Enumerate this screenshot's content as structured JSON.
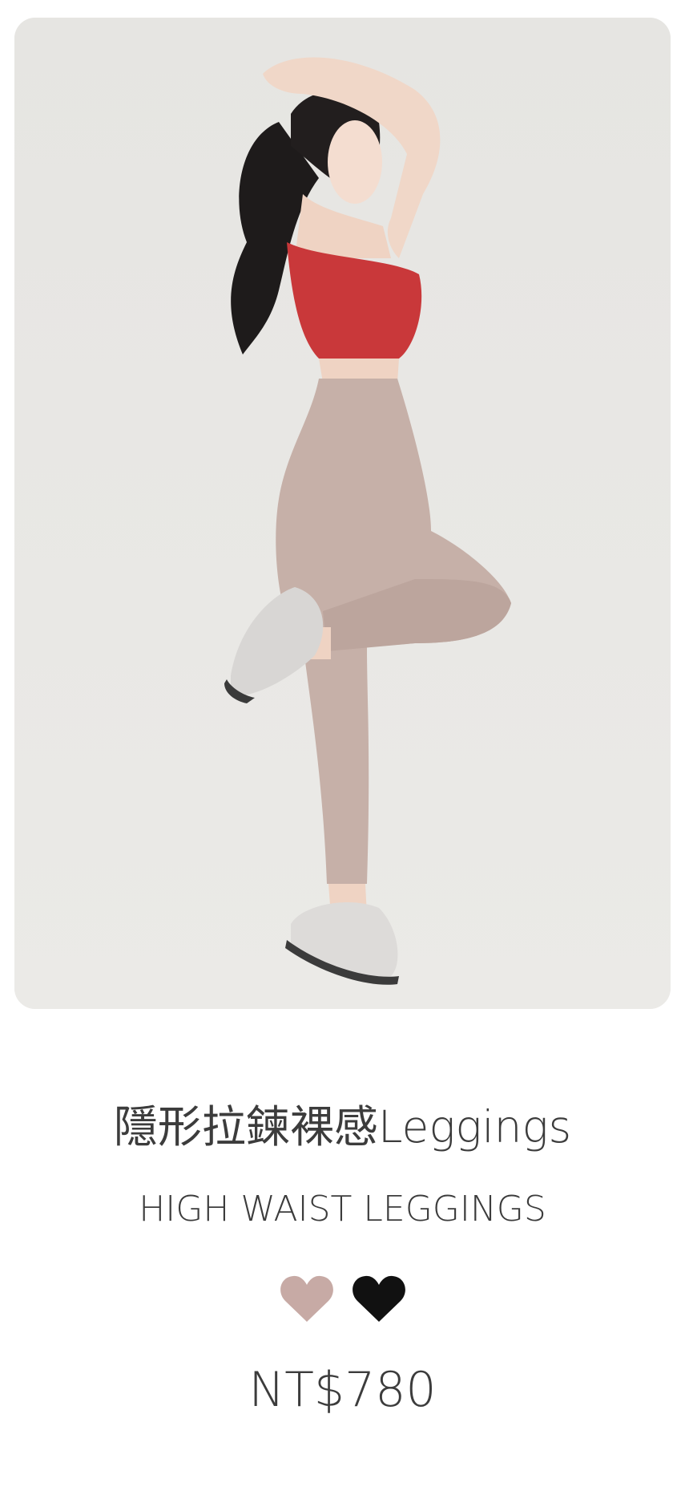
{
  "product": {
    "title": "隱形拉鍊裸感Leggings",
    "subtitle": "HIGH WAIST LEGGINGS",
    "price": "NT$780",
    "image_alt": "Model posing in red sports bra and taupe high waist leggings",
    "colors": [
      {
        "name": "taupe-swatch",
        "hex": "#c7aaa5"
      },
      {
        "name": "black-swatch",
        "hex": "#111111"
      }
    ]
  }
}
